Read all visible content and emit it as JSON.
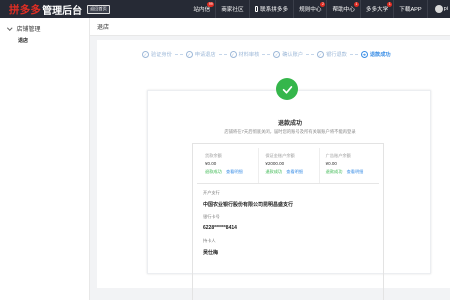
{
  "header": {
    "brand": "拼多多",
    "title": "管理后台",
    "return_badge": "返回首页",
    "nav": [
      {
        "label": "站内信",
        "badge": "99"
      },
      {
        "label": "商家社区"
      },
      {
        "label": "联系拼多多",
        "icon": "phone-icon"
      },
      {
        "label": "规则中心",
        "badge": "2"
      },
      {
        "label": "帮助中心",
        "badge": "1"
      },
      {
        "label": "多多大学",
        "badge": "1"
      },
      {
        "label": "下载APP"
      },
      {
        "label": "pi"
      }
    ]
  },
  "sidebar": {
    "section": "店铺管理",
    "items": [
      {
        "label": "退店"
      }
    ]
  },
  "breadcrumb": "退店",
  "steps": [
    {
      "label": "验证身份",
      "icon": "check-circle-icon"
    },
    {
      "label": "申请退店",
      "icon": "check-circle-icon"
    },
    {
      "label": "材料审核",
      "icon": "check-circle-icon"
    },
    {
      "label": "确认账户",
      "icon": "check-circle-icon"
    },
    {
      "label": "银行退款",
      "icon": "check-circle-icon"
    },
    {
      "label": "退款成功",
      "icon": "arrow-circle-icon",
      "active": true
    }
  ],
  "result": {
    "title": "退款成功",
    "description": "店铺将在7天后彻底关闭，届时您的账号及所有关联账户将不能再登录",
    "accounts": [
      {
        "label": "货款余额",
        "amount": "¥0.00",
        "status": "退款成功",
        "link": "查看明细"
      },
      {
        "label": "保证金账户余额",
        "amount": "¥2000.00",
        "status": "退款成功",
        "link": "查看明细"
      },
      {
        "label": "广告账户余额",
        "amount": "¥0.00",
        "status": "退款成功",
        "link": "查看明细"
      }
    ],
    "bank_label": "开户支行",
    "bank_value": "中国农业银行股份有限公司昆明昌盛支行",
    "card_label": "银行卡号",
    "card_value": "6228******8414",
    "holder_label": "持卡人",
    "holder_value": "吴仕梅"
  },
  "colors": {
    "topbar": "#262a35",
    "brand": "#e02e24",
    "success": "#35b64b",
    "link": "#3a8ee6"
  }
}
